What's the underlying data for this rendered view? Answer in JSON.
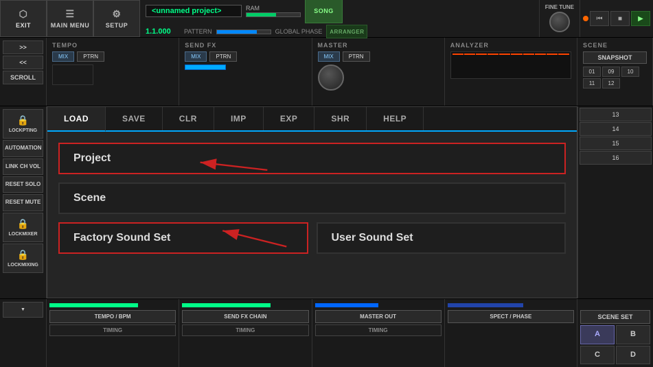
{
  "topBar": {
    "exitLabel": "EXIT",
    "mainMenuLabel": "MAIN MENU",
    "setupLabel": "SETUP",
    "projectName": "<unnamed project>",
    "ramLabel": "RAM",
    "ramPercent": 55,
    "patternValue": "1.1.000",
    "patternLabel": "PATTERN",
    "globalPhaseLabel": "GLOBAL PHASE",
    "songLabel": "SONG",
    "arrangerLabel": "ARRANGER",
    "fineTuneLabel": "FINE TUNE"
  },
  "secondRow": {
    "scrollLabel": "SCROLL",
    "upLabel": ">>",
    "downLabel": "<<",
    "tempo": {
      "title": "TEMPO",
      "mixLabel": "MIX",
      "ptnLabel": "PTRN"
    },
    "sendFx": {
      "title": "SEND FX",
      "mixLabel": "MIX",
      "ptnLabel": "PTRN"
    },
    "master": {
      "title": "MASTER",
      "mixLabel": "MIX",
      "ptnLabel": "PTRN"
    },
    "analyzer": {
      "title": "ANALYZER"
    },
    "scene": {
      "title": "SCENE",
      "snapshotLabel": "SNAPSHOT",
      "nums": [
        "01",
        "09",
        "10",
        "11",
        "12",
        "13",
        "14",
        "15",
        "16"
      ]
    }
  },
  "dialog": {
    "tabs": [
      {
        "label": "LOAD",
        "active": true
      },
      {
        "label": "SAVE",
        "active": false
      },
      {
        "label": "CLR",
        "active": false
      },
      {
        "label": "IMP",
        "active": false
      },
      {
        "label": "EXP",
        "active": false
      },
      {
        "label": "SHR",
        "active": false
      },
      {
        "label": "HELP",
        "active": false
      }
    ],
    "projectLabel": "Project",
    "sceneLabel": "Scene",
    "factorySoundSetLabel": "Factory Sound Set",
    "userSoundSetLabel": "User Sound Set"
  },
  "leftPanel": {
    "lockPtingLabel": "LOCKPTING",
    "automationLabel": "AUTOMATION",
    "linkChVolLabel": "LINK CH VOL",
    "resetSoldLabel": "RESET SOLO",
    "resetMuteLabel": "RESET MUTE",
    "lockMixerLabel": "LOCKMIXER",
    "lockMixingLabel": "LOCKMIXING"
  },
  "bottomArea": {
    "tempoBpmLabel": "TEMPO / BPM",
    "sendFxChainLabel": "SEND FX CHAIN",
    "masterOutLabel": "MASTER OUT",
    "spectPhaseLabel": "SPECT / PHASE",
    "timingLabel": "TIMING",
    "sceneSetLabel": "SCENE SET",
    "abcdBtns": [
      "A",
      "B",
      "C",
      "D"
    ]
  }
}
